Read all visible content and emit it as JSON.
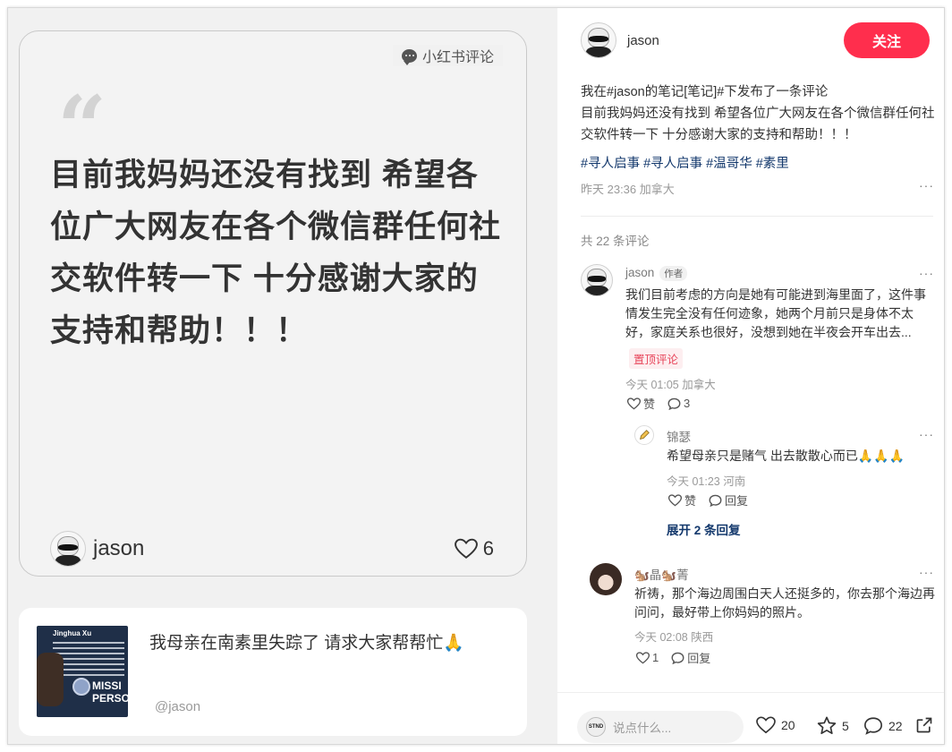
{
  "left": {
    "card_tag": "小红书评论",
    "quote_mark": "“",
    "card_text": "目前我妈妈还没有找到 希望各位广大网友在各个微信群任何社交软件转一下 十分感谢大家的支持和帮助！！！",
    "card_user": "jason",
    "card_likes": "6",
    "post_title": "我母亲在南素里失踪了 请求大家帮帮忙🙏",
    "post_handle": "@jason",
    "thumb_name": "Jinghua Xu",
    "thumb_missing": "MISSI\nPERSO"
  },
  "header": {
    "username": "jason",
    "follow_label": "关注"
  },
  "note": {
    "line1": "我在#jason的笔记[笔记]#下发布了一条评论",
    "line2": "目前我妈妈还没有找到 希望各位广大网友在各个微信群任何社交软件转一下 十分感谢大家的支持和帮助！！！",
    "tags": [
      "#寻人启事",
      "#寻人启事",
      "#温哥华",
      "#素里"
    ],
    "meta": "昨天 23:36 加拿大",
    "more": "···"
  },
  "comments_count": "共 22 条评论",
  "comments": [
    {
      "name": "jason",
      "badge": "作者",
      "text": "我们目前考虑的方向是她有可能进到海里面了，这件事情发生完全没有任何迹象，她两个月前只是身体不太好，家庭关系也很好，没想到她在半夜会开车出去...",
      "pin": "置顶评论",
      "meta": "今天 01:05 加拿大",
      "like_label": "赞",
      "reply_count": "3"
    },
    {
      "name": "锦瑟",
      "text": "希望母亲只是赌气 出去散散心而已🙏🙏🙏",
      "meta": "今天 01:23 河南",
      "like_label": "赞",
      "reply_label": "回复"
    },
    {
      "name": "🐿️晶🐿️菁",
      "text": "祈祷，那个海边周围白天人还挺多的，你去那个海边再问问，最好带上你妈妈的照片。",
      "meta": "今天 02:08 陕西",
      "like_count": "1",
      "reply_label": "回复"
    }
  ],
  "expand_label": "展开 2 条回复",
  "footer": {
    "placeholder": "说点什么...",
    "mini_avatar_text": "STND",
    "likes": "20",
    "stars": "5",
    "comments": "22"
  },
  "colors": {
    "accent": "#ff2e4d",
    "link": "#13386c",
    "pin": "#e8455a"
  }
}
